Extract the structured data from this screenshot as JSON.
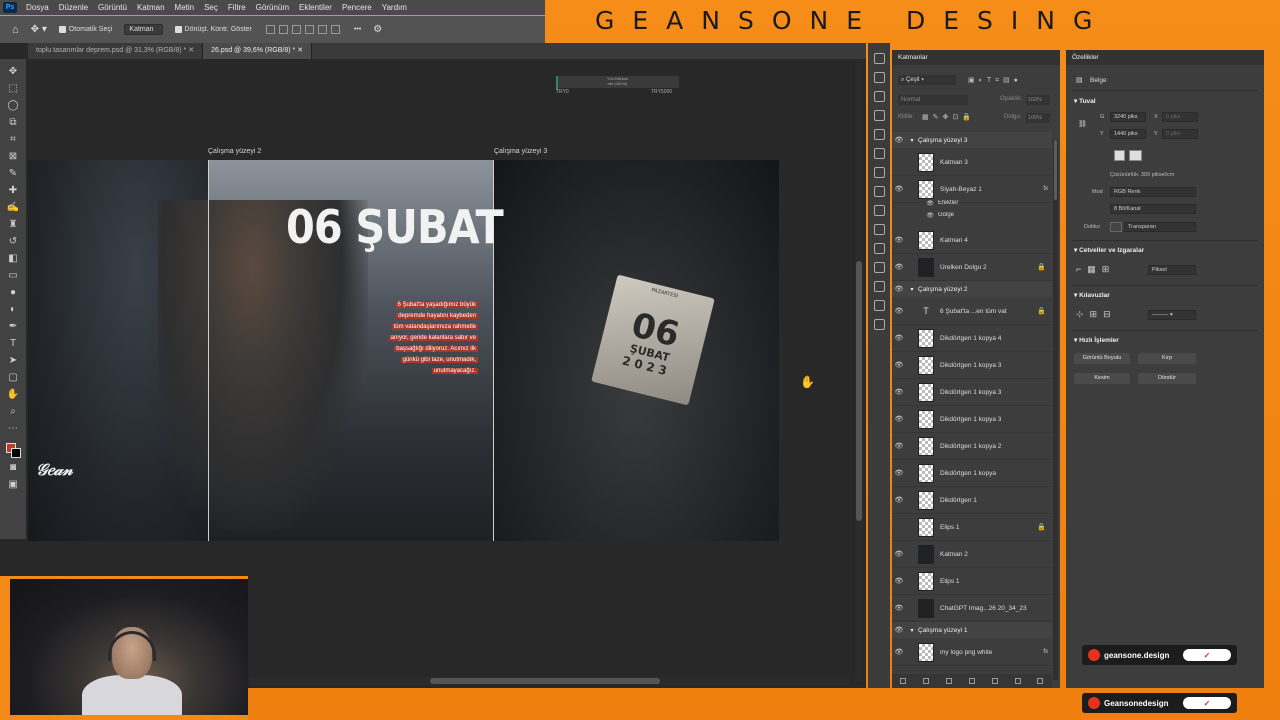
{
  "menu": {
    "ps_logo": "Ps",
    "items": [
      "Dosya",
      "Düzenle",
      "Görüntü",
      "Katman",
      "Metin",
      "Seç",
      "Filtre",
      "Görünüm",
      "Eklentiler",
      "Pencere",
      "Yardım"
    ]
  },
  "brand": {
    "title": "GEANSONE DESING"
  },
  "options": {
    "auto_select": "Otomatik Seçi",
    "auto_select_target": "Katman",
    "show_transform": "Dönüşt. Kontr. Göster",
    "more": "•••"
  },
  "doc_tabs": [
    {
      "label": "toplu tasarımlar deprem.psd @ 31,3% (RGB/8) *",
      "active": false
    },
    {
      "label": "26.psd @ 39,6% (RGB/8) *",
      "active": true
    }
  ],
  "canvas": {
    "artboard_2_label": "Çalışma yüzeyi 2",
    "artboard_3_label": "Çalışma yüzeyi 3",
    "slider_title": "Yön Bilekon",
    "slider_value": "rde (100%)",
    "slider_min": "TRY0",
    "slider_max": "TRY5000",
    "headline": "06 ŞUBAT",
    "paragraph": [
      "6 Şubat'ta yaşadığımız büyük",
      "depremde hayatını kaybeden",
      "tüm vatandaşlarımıza rahmetle",
      "anıyor, geride kalanlara sabır ve",
      "başsağlığı diliyoruz. Acımız ilk",
      "günkü gibi taze, unutmadık,",
      "unutmayacağız."
    ],
    "calendar_top": "PAZARTESİ",
    "calendar_day": "06",
    "calendar_month": "ŞUBAT",
    "calendar_year": "2023",
    "logo_text": "GEANSONE"
  },
  "layers_panel": {
    "title": "Katmanlar",
    "filter": "Çeşit",
    "blend_mode": "Normal",
    "opacity_label": "Opaklık:",
    "opacity_value": "100%",
    "lock_label": "Kilitle:",
    "fill_label": "Dolgu:",
    "fill_value": "100%",
    "rows": [
      {
        "type": "group",
        "name": "Çalışma yüzeyi 3"
      },
      {
        "type": "layer",
        "name": "Katman 3",
        "visible": false,
        "thumb": "trans",
        "lock": false
      },
      {
        "type": "layer",
        "name": "Siyah-Beyaz 1",
        "visible": true,
        "thumb": "trans",
        "lock": false,
        "fx": true
      },
      {
        "type": "effects",
        "name": "Efektler"
      },
      {
        "type": "effect",
        "name": "Gölge"
      },
      {
        "type": "layer",
        "name": "Katman 4",
        "visible": true,
        "thumb": "trans",
        "lock": false
      },
      {
        "type": "layer",
        "name": "Ürelken Dolgu 2",
        "visible": true,
        "thumb": "dark",
        "lock": true
      },
      {
        "type": "group",
        "name": "Çalışma yüzeyi 2"
      },
      {
        "type": "layer",
        "name": "6 Şubat'ta ...en tüm vat",
        "visible": true,
        "thumb": "text",
        "lock": true
      },
      {
        "type": "layer",
        "name": "Dikdörtgen 1 kopya 4",
        "visible": true,
        "thumb": "trans",
        "lock": false
      },
      {
        "type": "layer",
        "name": "Dikdörtgen 1 kopya 3",
        "visible": true,
        "thumb": "trans",
        "lock": false
      },
      {
        "type": "layer",
        "name": "Dikdörtgen 1 kopya 3",
        "visible": true,
        "thumb": "trans",
        "lock": false
      },
      {
        "type": "layer",
        "name": "Dikdörtgen 1 kopya 3",
        "visible": true,
        "thumb": "trans",
        "lock": false
      },
      {
        "type": "layer",
        "name": "Dikdörtgen 1 kopya 2",
        "visible": true,
        "thumb": "trans",
        "lock": false
      },
      {
        "type": "layer",
        "name": "Dikdörtgen 1 kopya",
        "visible": true,
        "thumb": "trans",
        "lock": false
      },
      {
        "type": "layer",
        "name": "Dikdörtgen 1",
        "visible": true,
        "thumb": "trans",
        "lock": false
      },
      {
        "type": "layer",
        "name": "Elips 1",
        "visible": false,
        "thumb": "trans",
        "lock": true
      },
      {
        "type": "layer",
        "name": "Katman 2",
        "visible": true,
        "thumb": "dark",
        "lock": false
      },
      {
        "type": "layer",
        "name": "Elips 1",
        "visible": true,
        "thumb": "trans",
        "lock": false
      },
      {
        "type": "layer",
        "name": "ChatGPT Imag...26 20_34_23",
        "visible": true,
        "thumb": "dark",
        "lock": false
      },
      {
        "type": "group",
        "name": "Çalışma yüzeyi 1"
      },
      {
        "type": "layer",
        "name": "my logo png white",
        "visible": true,
        "thumb": "trans",
        "lock": false,
        "fx": true
      }
    ]
  },
  "properties": {
    "title": "Özellikler",
    "doc_label": "Belge",
    "canvas_section": "Tuval",
    "width_label": "G",
    "width_value": "3240 piks",
    "height_label": "Y",
    "height_value": "1440 piks",
    "x_label": "X",
    "x_value": "0 piks",
    "y_label": "Y",
    "y_value": "0 piks",
    "resolution": "Çözünürlük: 300 piksel/cm",
    "mode_label": "Mod",
    "mode_value": "RGB Renk",
    "depth_value": "8 Bit/Kanal",
    "fill_label": "Doldur",
    "fill_value": "Transparan",
    "rulers_section": "Cetveller ve Izgaralar",
    "ruler_unit": "Piksel",
    "guides_section": "Kılavuzlar",
    "quick_section": "Hızlı İşlemler",
    "btn_image_size": "Görüntü Boyutu",
    "btn_crop": "Kırp",
    "btn_trim": "Kesim",
    "btn_rotate": "Döndür"
  },
  "social": [
    {
      "handle": "geansone.design"
    },
    {
      "handle": "Geansonedesign"
    }
  ]
}
